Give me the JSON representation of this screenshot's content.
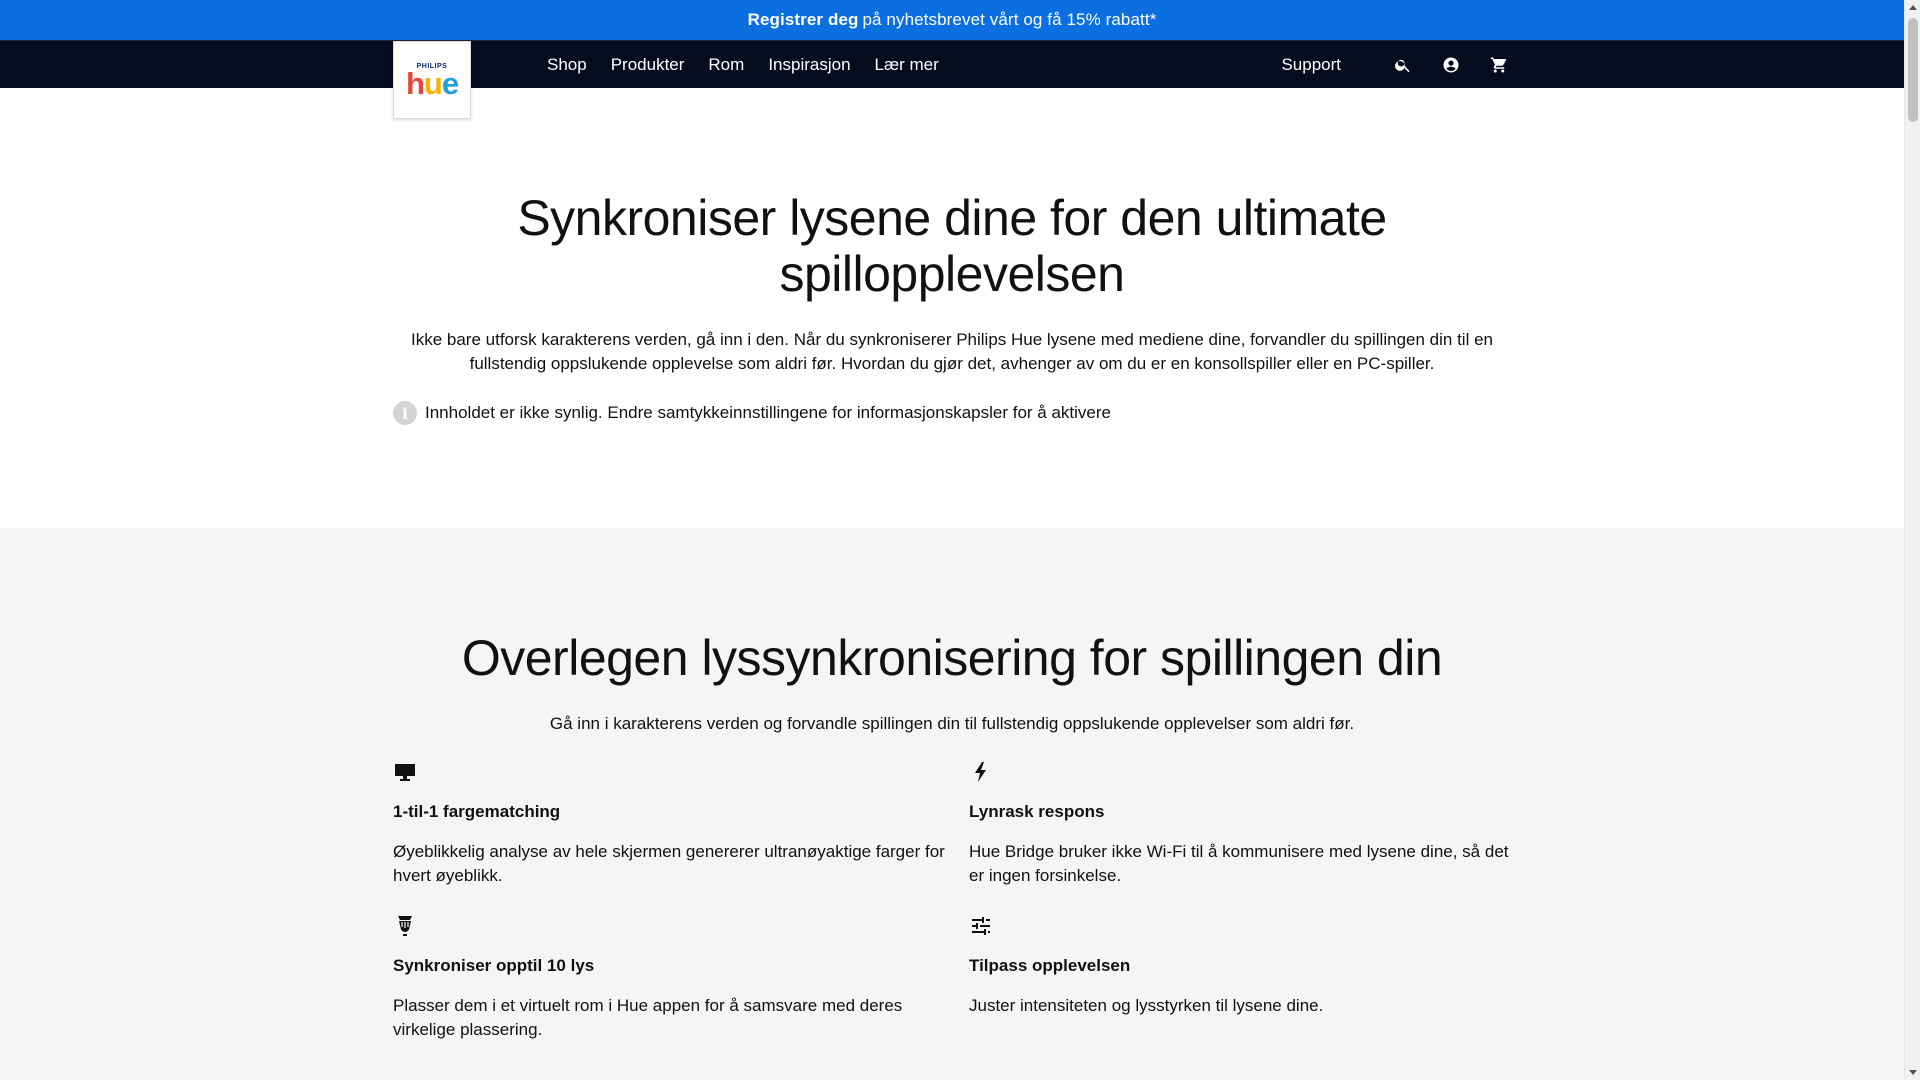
{
  "promo": {
    "bold": "Registrer deg",
    "text": "på nyhetsbrevet vårt og få 15% rabatt*"
  },
  "logo": {
    "brand": "PHILIPS",
    "h": "h",
    "u": "u",
    "e": "e"
  },
  "nav": {
    "links": [
      "Shop",
      "Produkter",
      "Rom",
      "Inspirasjon",
      "Lær mer"
    ],
    "support": "Support",
    "icons": [
      "search-icon",
      "account-icon",
      "cart-icon"
    ]
  },
  "hero": {
    "title": "Synkroniser lysene dine for den ultimate spillopplevelsen",
    "text": "Ikke bare utforsk karakterens verden, gå inn i den. Når du synkroniserer Philips Hue lysene med mediene dine, forvandler du spillingen din til en fullstendig oppslukende opplevelse som aldri før. Hvordan du gjør det, avhenger av om du er en konsollspiller eller en PC-spiller.",
    "notice": "Innholdet er ikke synlig. Endre samtykkeinnstillingene for informasjonskapsler for å aktivere",
    "notice_icon": "info-icon"
  },
  "features": {
    "title": "Overlegen lyssynkronisering for spillingen din",
    "subtitle": "Gå inn i karakterens verden og forvandle spillingen din til fullstendig oppslukende opplevelser som aldri før.",
    "items": [
      {
        "icon": "monitor-icon",
        "title": "1-til-1 fargematching",
        "text": "Øyeblikkelig analyse av hele skjermen genererer ultranøyaktige farger for hvert øyeblikk."
      },
      {
        "icon": "lightning-icon",
        "title": "Lynrask respons",
        "text": "Hue Bridge bruker ikke Wi-Fi til å kommunisere med lysene dine, så det er ingen forsinkelse."
      },
      {
        "icon": "lights-icon",
        "title": "Synkroniser opptil 10 lys",
        "text": "Plasser dem i et virtuelt rom i Hue appen for å samsvare med deres virkelige plassering."
      },
      {
        "icon": "sliders-icon",
        "title": "Tilpass opplevelsen",
        "text": "Juster intensiteten og lysstyrken til lysene dine."
      }
    ]
  },
  "colors": {
    "promo": "#0b6fe0",
    "nav": "#050c1e",
    "features_bg": "#f5f5f5"
  }
}
